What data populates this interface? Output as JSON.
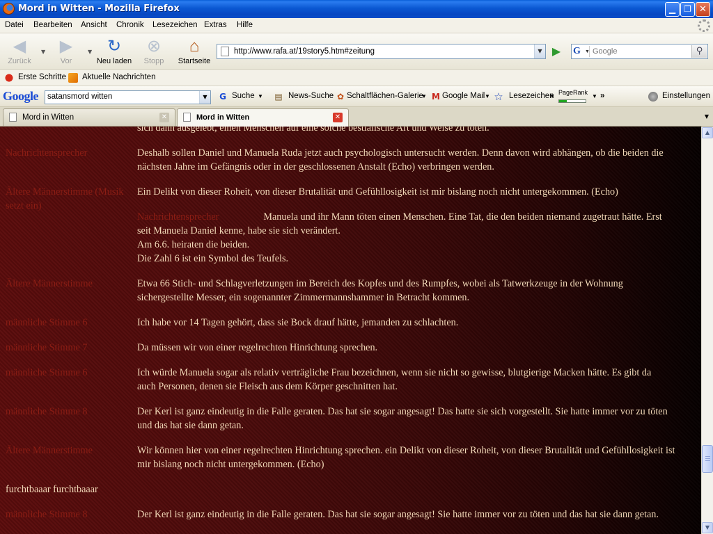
{
  "window": {
    "title": "Mord in Witten - Mozilla Firefox"
  },
  "menu": [
    "Datei",
    "Bearbeiten",
    "Ansicht",
    "Chronik",
    "Lesezeichen",
    "Extras",
    "Hilfe"
  ],
  "nav": {
    "back": "Zurück",
    "forward": "Vor",
    "reload": "Neu laden",
    "stop": "Stopp",
    "home": "Startseite",
    "url": "http://www.rafa.at/19story5.htm#zeitung",
    "search_placeholder": "Google"
  },
  "bookmarks": [
    "Erste Schritte",
    "Aktuelle Nachrichten"
  ],
  "google_toolbar": {
    "logo": "Google",
    "query": "satansmord witten",
    "search": "Suche",
    "news": "News-Suche",
    "gallery": "Schaltflächen-Galerie",
    "mail": "Google Mail",
    "bookmarks": "Lesezeichen",
    "pagerank": "PageRank",
    "more": "»",
    "settings": "Einstellungen"
  },
  "tabs": [
    {
      "label": "Mord in Witten",
      "active": false
    },
    {
      "label": "Mord in Witten",
      "active": true
    }
  ],
  "content": {
    "top_fragment": "sich dann ausgelebt, einen Menschen auf eine solche bestialische Art und Weise zu töten.",
    "rows": [
      {
        "speaker": "Nachrichtensprecher",
        "lines": [
          "Deshalb sollen Daniel und Manuela Ruda jetzt auch psychologisch untersucht werden. Denn davon wird abhängen, ob die beiden die",
          "nächsten Jahre im Gefängnis oder in der geschlossenen Anstalt (Echo) verbringen werden."
        ]
      },
      {
        "speaker": "Ältere Männerstimme (Musik setzt ein)",
        "lines": [
          "Ein Delikt von dieser Roheit, von dieser Brutalität und Gefühllosigkeit ist mir bislang noch nicht untergekommen. (Echo)"
        ]
      },
      {
        "inline_speaker": "Nachrichtensprecher",
        "lines": [
          "Manuela und ihr Mann töten einen Menschen. Eine Tat, die den beiden niemand zugetraut hätte. Erst",
          "seit Manuela Daniel kenne, habe sie sich verändert.",
          "Am 6.6. heiraten die beiden.",
          "Die Zahl 6 ist ein Symbol des Teufels."
        ]
      },
      {
        "speaker": "Ältere Männerstimme",
        "lines": [
          "Etwa 66 Stich- und Schlagverletzungen im Bereich des Kopfes und des Rumpfes, wobei als Tatwerkzeuge in der Wohnung",
          "sichergestellte Messer, ein sogenannter Zimmermannshammer in Betracht kommen."
        ]
      },
      {
        "speaker": "männliche Stimme 6",
        "lines": [
          "Ich habe vor 14 Tagen gehört, dass sie Bock drauf hätte, jemanden zu schlachten."
        ]
      },
      {
        "speaker": "männliche Stimme 7",
        "lines": [
          "Da müssen wir von einer regelrechten Hinrichtung sprechen."
        ]
      },
      {
        "speaker": "männliche Stimme 6",
        "lines": [
          "Ich würde Manuela sogar als relativ verträgliche Frau bezeichnen, wenn sie nicht so gewisse, blutgierige Macken hätte. Es gibt da",
          "auch Personen, denen sie Fleisch aus dem Körper geschnitten hat."
        ]
      },
      {
        "speaker": "männliche Stimme 8",
        "lines": [
          "Der Kerl ist ganz eindeutig in die Falle geraten. Das hat sie sogar angesagt! Das hatte sie sich vorgestellt. Sie hatte immer vor zu töten",
          "und das hat sie dann getan."
        ]
      },
      {
        "speaker": "Ältere Männerstimme",
        "lines": [
          "Wir können hier von einer regelrechten Hinrichtung sprechen. ein Delikt von dieser Roheit, von dieser Brutalität und Gefühllosigkeit ist",
          "mir bislang noch nicht untergekommen. (Echo)"
        ]
      },
      {
        "plain": "furchtbaaar furchtbaaar"
      },
      {
        "speaker": "männliche Stimme 8",
        "lines": [
          "Der Kerl ist ganz eindeutig in die Falle geraten. Das hat sie sogar angesagt! Sie hatte immer vor zu töten und das hat sie dann getan."
        ]
      }
    ]
  },
  "colors": {
    "speaker": "#8b1d14",
    "speech": "#f2d9b8",
    "titlebar": "#0b58d2"
  }
}
